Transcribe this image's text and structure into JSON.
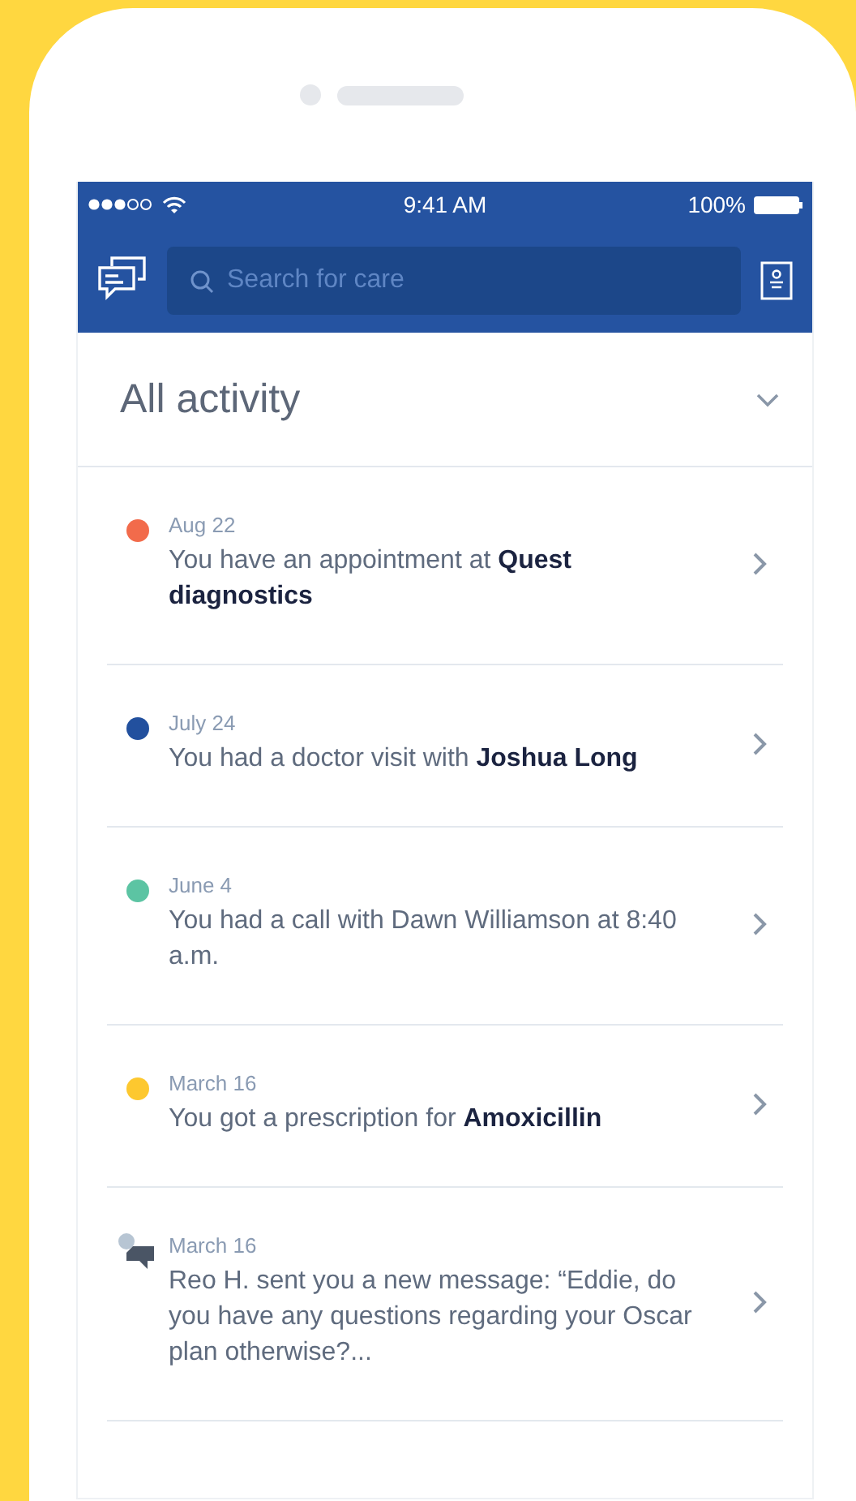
{
  "status_bar": {
    "time": "9:41 AM",
    "battery": "100%"
  },
  "nav": {
    "search": {
      "placeholder": "Search for care"
    }
  },
  "header": {
    "title": "All activity"
  },
  "activities": [
    {
      "kind": "dot",
      "color": "#f26b4b",
      "date": "Aug 22",
      "text": "You have an appointment at **Quest diagnostics**"
    },
    {
      "kind": "dot",
      "color": "#22509e",
      "date": "July 24",
      "text": "You had a doctor visit with **Joshua Long**"
    },
    {
      "kind": "dot",
      "color": "#5cc4a3",
      "date": "June 4",
      "text": "You had a call with Dawn Williamson at 8:40 a.m."
    },
    {
      "kind": "dot",
      "color": "#fdc82f",
      "date": "March 16",
      "text": "You got a prescription for **Amoxicillin**"
    },
    {
      "kind": "message",
      "date": "March 16",
      "text": "Reo H. sent you a new message: “Eddie, do you have any questions regarding your Oscar plan otherwise?..."
    }
  ]
}
